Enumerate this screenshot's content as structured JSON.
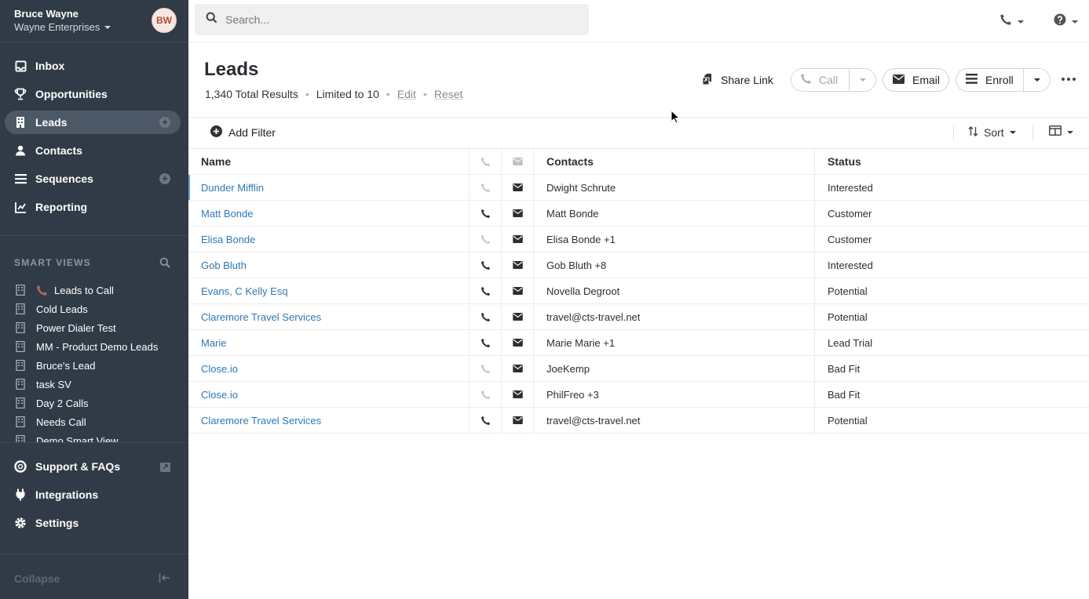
{
  "user": {
    "name": "Bruce Wayne",
    "org": "Wayne Enterprises",
    "initials": "BW"
  },
  "nav": [
    {
      "label": "Inbox",
      "icon": "inbox-icon"
    },
    {
      "label": "Opportunities",
      "icon": "trophy-icon"
    },
    {
      "label": "Leads",
      "icon": "building-icon",
      "active": true
    },
    {
      "label": "Contacts",
      "icon": "person-icon"
    },
    {
      "label": "Sequences",
      "icon": "list-icon"
    },
    {
      "label": "Reporting",
      "icon": "chart-icon"
    }
  ],
  "smart_views": {
    "title": "SMART VIEWS",
    "items": [
      "Leads to Call",
      "Cold Leads",
      "Power Dialer Test",
      "MM - Product Demo Leads",
      "Bruce's Lead",
      "task SV",
      "Day 2 Calls",
      "Needs Call",
      "Demo Smart View"
    ]
  },
  "bottom_nav": [
    {
      "label": "Support & FAQs",
      "icon": "lifebuoy-icon"
    },
    {
      "label": "Integrations",
      "icon": "plug-icon"
    },
    {
      "label": "Settings",
      "icon": "gear-icon"
    }
  ],
  "collapse_label": "Collapse",
  "search": {
    "placeholder": "Search..."
  },
  "page": {
    "title": "Leads",
    "total": "1,340 Total Results",
    "limit": "Limited to 10",
    "edit": "Edit",
    "reset": "Reset"
  },
  "actions": {
    "share": "Share Link",
    "call": "Call",
    "email": "Email",
    "enroll": "Enroll"
  },
  "toolbar": {
    "add_filter": "Add Filter",
    "sort": "Sort"
  },
  "table": {
    "headers": {
      "name": "Name",
      "contacts": "Contacts",
      "status": "Status"
    },
    "rows": [
      {
        "name": "Dunder Mifflin",
        "phone": false,
        "contacts": "Dwight Schrute",
        "status": "Interested"
      },
      {
        "name": "Matt Bonde",
        "phone": true,
        "contacts": "Matt Bonde",
        "status": "Customer"
      },
      {
        "name": "Elisa Bonde",
        "phone": false,
        "contacts": "Elisa Bonde +1",
        "status": "Customer"
      },
      {
        "name": "Gob Bluth",
        "phone": true,
        "contacts": "Gob Bluth +8",
        "status": "Interested"
      },
      {
        "name": "Evans, C Kelly Esq",
        "phone": true,
        "contacts": "Novella Degroot",
        "status": "Potential"
      },
      {
        "name": "Claremore Travel Services",
        "phone": true,
        "contacts": "travel@cts-travel.net",
        "status": "Potential"
      },
      {
        "name": "Marie",
        "phone": true,
        "contacts": "Marie Marie +1",
        "status": "Lead Trial"
      },
      {
        "name": "Close.io",
        "phone": false,
        "contacts": "JoeKemp",
        "status": "Bad Fit"
      },
      {
        "name": "Close.io",
        "phone": false,
        "contacts": "PhilFreo +3",
        "status": "Bad Fit"
      },
      {
        "name": "Claremore Travel Services",
        "phone": true,
        "contacts": "travel@cts-travel.net",
        "status": "Potential"
      }
    ]
  }
}
